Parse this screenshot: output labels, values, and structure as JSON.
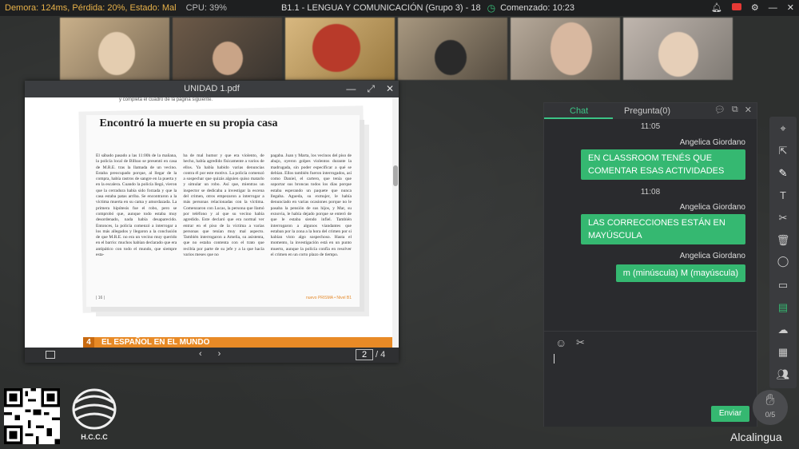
{
  "status_bar": {
    "network": "Demora: 124ms, Pérdida: 20%, Estado:  Mal",
    "cpu": "CPU: 39%",
    "class_title": "B1.1 - LENGUA Y COMUNICACIÓN (Grupo 3) - 18",
    "started": "Comenzado: 10:23"
  },
  "pdf": {
    "title": "UNIDAD 1.pdf",
    "article_title": "Encontró la muerte en su propia casa",
    "cut_line": "y completa el cuadro de la página siguiente.",
    "col1": "El sábado pasado a las 11:00h de la mañana, la policía local de Bilbao se presentó en casa de M.R.E. tras la llamada de un vecino. Estaba preocupado porque, al llegar de la compra, había rastros de sangre en la puerta y en la escalera. Cuando la policía llegó, vieron que la cerradura había sido forzada y que la casa estaba patas arriba. Se encontraron a la víctima muerta en su cama y amordazada. La primera hipótesis fue el robo, pero se comprobó que, aunque todo estaba muy desordenado, nada había desaparecido. Entonces, la policía comenzó a interrogar a los más allegados y llegaron a la conclusión de que M.R.E. no era un vecino muy querido en el barrio: muchos habían declarado que era antipático con todo el mundo, que siempre esta-",
    "col2": "ba de mal humor y que era violento, de hecho, había agredido físicamente a varios de ellos. Ya había habido varias denuncias contra él por este motivo. La policía comenzó a sospechar que quizás alguien quiso matarlo y simular un robo. Así que, mientras un inspector se dedicaba a investigar la escena del crimen, otros empezaron a interrogar a más personas relacionadas con la víctima. Comenzaron con Lucas, la persona que llamó por teléfono y al que su vecino había agredido. Este declaró que era normal ver entrar en el piso de la víctima a varias personas que tenían muy mal aspecto. También interrogaron a Amelia, su asistenta, que no estaba contenta con el trato que recibía por parte de su jefe y a la que hacía varios meses que no",
    "col3": "pagaba. Juan y Marta, los vecinos del piso de abajo, oyeron golpes violentos durante la madrugada, sin poder especificar a qué se debían. Ellos también fueron interrogados, así como Daniel, el cartero, que tenía que soportar sus broncas todos los días porque estaba esperando un paquete que nunca llegaba. Agueda, su exmujer, le había denunciado en varias ocasiones porque no le pasaba la pensión de sus hijos, y Mar, su exnovia, le había dejado porque se enteró de que le estaba siendo infiel. También interrogaron a algunos viandantes que estaban por la zona a la hora del crimen por si habían visto algo sospechoso. Hasta el momento, la investigación está en un punto muerto, aunque la policía confía en resolver el crimen en un corto plazo de tiempo.",
    "page_num_label": "| 16 |",
    "publisher": "nuevo PRISMA • Nivel B1",
    "section_number": "4",
    "section_label": "EL ESPAÑOL EN EL MUNDO",
    "current_page": "2",
    "total_pages": "/ 4"
  },
  "chat": {
    "tab_chat": "Chat",
    "tab_question": "Pregunta(0)",
    "messages": [
      {
        "time": "11:05",
        "sender": "Angelica Giordano",
        "text_line1": "EN CLASSROOM TENÉS QUE",
        "text_line2": "COMENTAR ESAS ACTIVIDADES"
      },
      {
        "time": "11:08",
        "sender": "Angelica Giordano",
        "text_line1": "LAS CORRECCIONES ESTÁN EN",
        "text_line2": "MAYÚSCULA"
      },
      {
        "sender": "Angelica Giordano",
        "text": "m (minúscula) M (mayúscula)"
      }
    ],
    "send_label": "Enviar"
  },
  "hand_raise": {
    "count": "0/5"
  },
  "brand": "Alcalingua",
  "logo_text": "H.C.C.C",
  "colors": {
    "accent": "#35b871",
    "warning": "#e8b24a",
    "section": "#e88a26"
  }
}
